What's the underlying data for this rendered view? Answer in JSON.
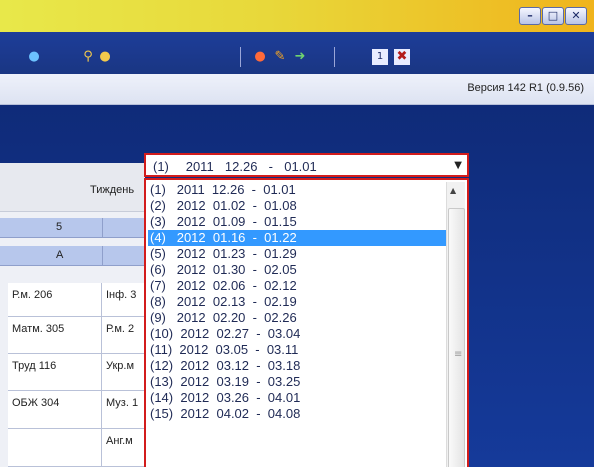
{
  "window": {
    "buttons": [
      "minimize",
      "maximize",
      "close"
    ]
  },
  "version": "Версия 142 R1 (0.9.56)",
  "week_label": "Тиждень",
  "header_rows": [
    "5",
    "A"
  ],
  "grid": {
    "rows": [
      [
        "Р.м. 206",
        "Інф. 3"
      ],
      [
        "Матм. 305",
        "Р.м. 2"
      ],
      [
        "Труд 116",
        "Укр.м"
      ],
      [
        "ОБЖ 304",
        "Муз. 1"
      ],
      [
        "",
        "Анг.м"
      ]
    ]
  },
  "dropdown": {
    "selected": "(1)   2011  12.26  -  01.01",
    "options": [
      "(1)   2011  12.26  -  01.01",
      "(2)   2012  01.02  -  01.08",
      "(3)   2012  01.09  -  01.15",
      "(4)   2012  01.16  -  01.22",
      "(5)   2012  01.23  -  01.29",
      "(6)   2012  01.30  -  02.05",
      "(7)   2012  02.06  -  02.12",
      "(8)   2012  02.13  -  02.19",
      "(9)   2012  02.20  -  02.26",
      "(10)  2012  02.27  -  03.04",
      "(11)  2012  03.05  -  03.11",
      "(12)  2012  03.12  -  03.18",
      "(13)  2012  03.19  -  03.25",
      "(14)  2012  03.26  -  04.01",
      "(15)  2012  04.02  -  04.08"
    ],
    "highlighted_index": 3
  },
  "colors": {
    "highlight": "#3399ff",
    "dropdown_border": "#d21c1c",
    "background": "#14307e"
  }
}
